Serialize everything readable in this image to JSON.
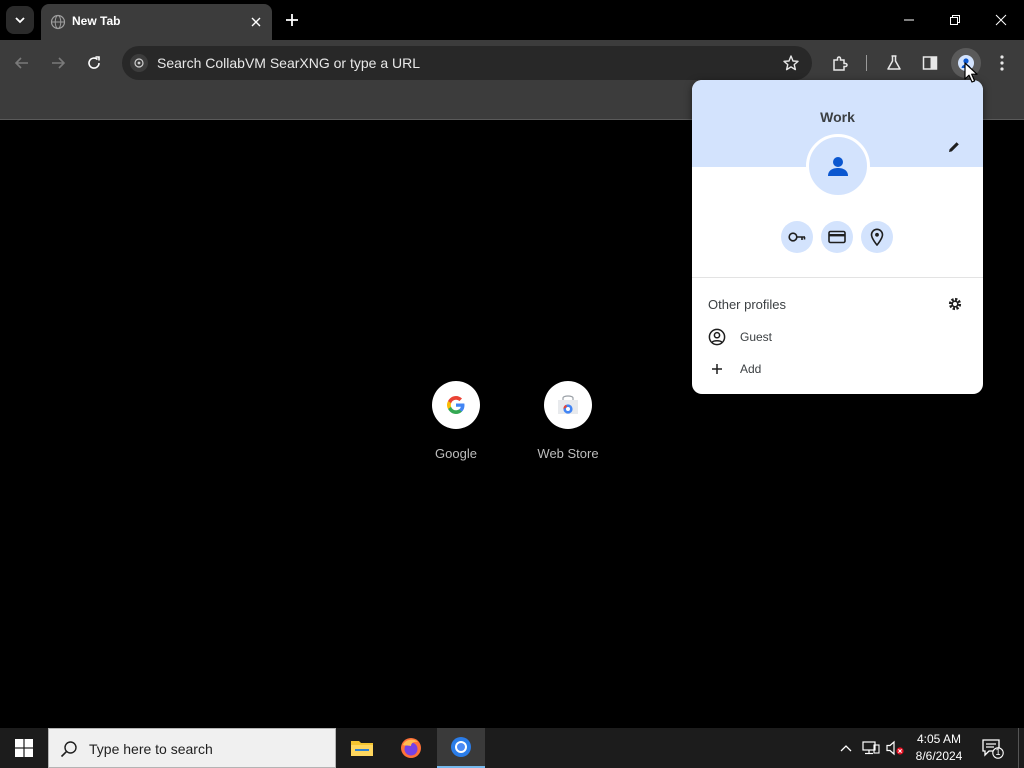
{
  "browser": {
    "tab": {
      "title": "New Tab"
    },
    "omnibox": {
      "placeholder": "Search CollabVM SearXNG or type a URL"
    }
  },
  "new_tab_page": {
    "shortcuts": [
      {
        "label": "Google"
      },
      {
        "label": "Web Store"
      }
    ]
  },
  "profile_menu": {
    "profile_name": "Work",
    "other_profiles_title": "Other profiles",
    "items": [
      {
        "label": "Guest",
        "icon": "guest-icon"
      },
      {
        "label": "Add",
        "icon": "plus-icon"
      }
    ],
    "quick_actions": [
      "password-key-icon",
      "payment-card-icon",
      "location-pin-icon"
    ],
    "accent_color": "#d3e3fd",
    "icon_color": "#0b57d0"
  },
  "taskbar": {
    "search_placeholder": "Type here to search",
    "apps": [
      "file-explorer-icon",
      "firefox-icon",
      "chrome-icon"
    ],
    "time": "4:05 AM",
    "date": "8/6/2024",
    "notification_count": "1"
  }
}
